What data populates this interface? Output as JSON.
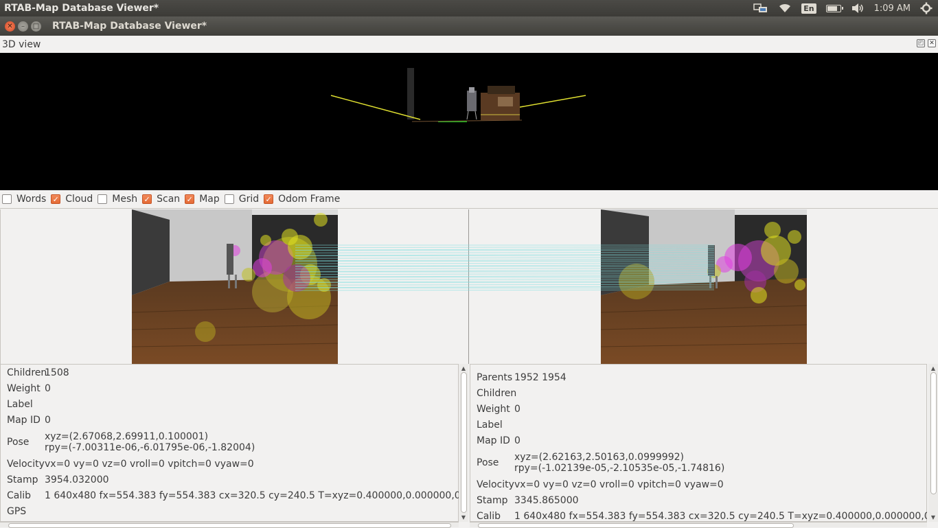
{
  "top_panel": {
    "app_title": "RTAB-Map Database Viewer*",
    "keyboard_layout": "En",
    "clock": "1:09 AM",
    "battery_level": 0.85
  },
  "window": {
    "title": "RTAB-Map Database Viewer*"
  },
  "dock": {
    "title": "3D view"
  },
  "checkboxes": [
    {
      "label": "Words",
      "checked": false
    },
    {
      "label": "Cloud",
      "checked": true
    },
    {
      "label": "Mesh",
      "checked": false
    },
    {
      "label": "Scan",
      "checked": true
    },
    {
      "label": "Map",
      "checked": true
    },
    {
      "label": "Grid",
      "checked": false
    },
    {
      "label": "Odom Frame",
      "checked": true
    }
  ],
  "left_info": {
    "rows": [
      {
        "key": "Children",
        "value": "1508"
      },
      {
        "key": "Weight",
        "value": "0"
      },
      {
        "key": "Label",
        "value": ""
      },
      {
        "key": "Map ID",
        "value": "0"
      }
    ],
    "pose": {
      "key": "Pose",
      "xyz": "xyz=(2.67068,2.69911,0.100001)",
      "rpy": "rpy=(-7.00311e-06,-6.01795e-06,-1.82004)"
    },
    "rows2": [
      {
        "key": "Velocity",
        "value": "vx=0 vy=0 vz=0 vroll=0 vpitch=0 vyaw=0"
      },
      {
        "key": "Stamp",
        "value": "3954.032000"
      },
      {
        "key": "Calib",
        "value": "1 640x480 fx=554.383 fy=554.383 cx=320.5 cy=240.5 T=xyz=0.400000,0.000000,0.00000"
      },
      {
        "key": "GPS",
        "value": ""
      }
    ]
  },
  "right_info": {
    "rows": [
      {
        "key": "Parents",
        "value": "1952 1954"
      },
      {
        "key": "Children",
        "value": ""
      },
      {
        "key": "Weight",
        "value": "0"
      },
      {
        "key": "Label",
        "value": ""
      },
      {
        "key": "Map ID",
        "value": "0"
      }
    ],
    "pose": {
      "key": "Pose",
      "xyz": "xyz=(2.62163,2.50163,0.0999992)",
      "rpy": "rpy=(-1.02139e-05,-2.10535e-05,-1.74816)"
    },
    "rows2": [
      {
        "key": "Velocity",
        "value": "vx=0 vy=0 vz=0 vroll=0 vpitch=0 vyaw=0"
      },
      {
        "key": "Stamp",
        "value": "3345.865000"
      },
      {
        "key": "Calib",
        "value": "1 640x480 fx=554.383 fy=554.383 cx=320.5 cy=240.5 T=xyz=0.400000,0.000000,0.00000"
      }
    ]
  },
  "colors": {
    "accent_checkbox": "#e46a35",
    "panel_bg": "#f2f1f0",
    "scan_line": "#e0e030",
    "match_line": "#7ee0e0"
  },
  "icons": [
    "network-icon",
    "wifi-icon",
    "battery-icon",
    "volume-icon",
    "gear-icon",
    "close-icon",
    "minimize-icon",
    "maximize-icon",
    "float-icon"
  ]
}
